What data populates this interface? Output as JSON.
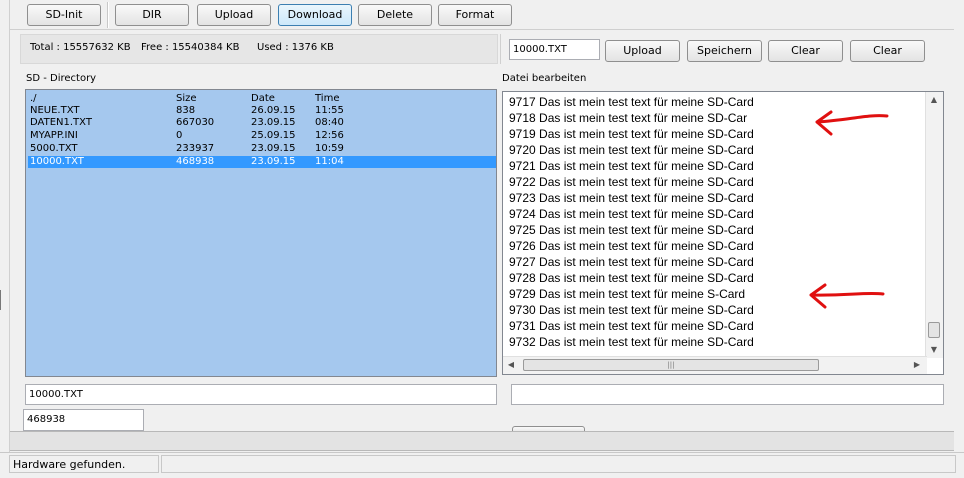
{
  "toolbar": {
    "buttons": [
      "SD-Init",
      "DIR",
      "Upload",
      "Download",
      "Delete",
      "Format"
    ]
  },
  "info": {
    "total": "Total : 15557632 KB",
    "free": "Free : 15540384 KB",
    "used": "Used : 1376 KB"
  },
  "right_controls": {
    "filename": "10000.TXT",
    "upload": "Upload",
    "speichern": "Speichern",
    "clear1": "Clear",
    "clear2": "Clear"
  },
  "directory": {
    "title": "SD - Directory",
    "headers": [
      "./",
      "Size",
      "Date",
      "Time"
    ],
    "rows": [
      [
        "NEUE.TXT",
        "838",
        "26.09.15",
        "11:55"
      ],
      [
        "DATEN1.TXT",
        "667030",
        "23.09.15",
        "08:40"
      ],
      [
        "MYAPP.INI",
        "0",
        "25.09.15",
        "12:56"
      ],
      [
        "5000.TXT",
        "233937",
        "23.09.15",
        "10:59"
      ],
      [
        "10000.TXT",
        "468938",
        "23.09.15",
        "11:04"
      ]
    ],
    "selected_row": 4
  },
  "editor": {
    "title": "Datei bearbeiten",
    "lines": [
      "9717 Das ist mein test text für meine SD-Card",
      "9718 Das ist mein test text für meine SD-Car",
      "9719 Das ist mein test text für meine SD-Card",
      "9720 Das ist mein test text für meine SD-Card",
      "9721 Das ist mein test text für meine SD-Card",
      "9722 Das ist mein test text für meine SD-Card",
      "9723 Das ist mein test text für meine SD-Card",
      "9724 Das ist mein test text für meine SD-Card",
      "9725 Das ist mein test text für meine SD-Card",
      "9726 Das ist mein test text für meine SD-Card",
      "9727 Das ist mein test text für meine SD-Card",
      "9728 Das ist mein test text für meine SD-Card",
      "9729 Das ist mein test text für meine S-Card",
      "9730 Das ist mein test text für meine SD-Card",
      "9731 Das ist mein test text für meine SD-Card",
      "9732 Das ist mein test text für meine SD-Card"
    ],
    "annotation_color": "#e01010"
  },
  "fields": {
    "selected_name": "10000.TXT",
    "selected_size": "468938",
    "right_field": ""
  },
  "status": {
    "text": "Hardware gefunden."
  }
}
